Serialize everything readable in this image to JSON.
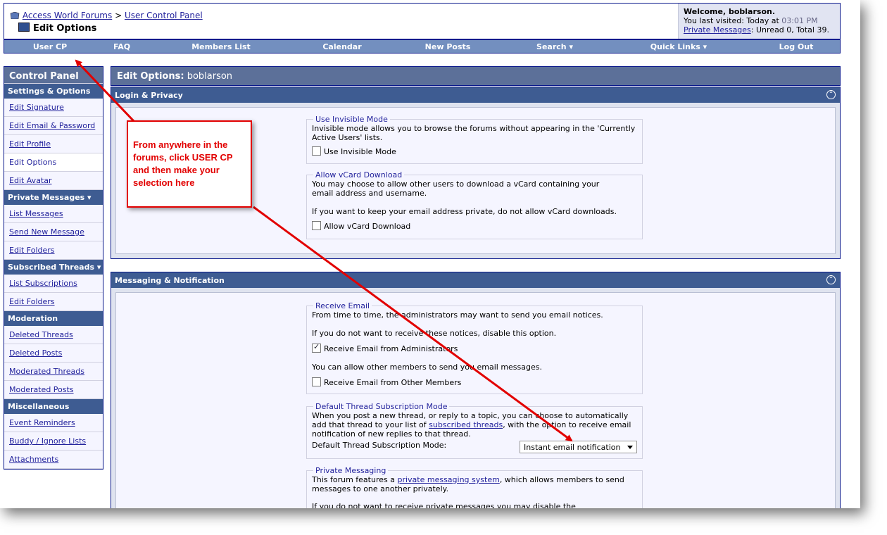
{
  "header": {
    "breadcrumb_home": "Access World Forums",
    "breadcrumb_sep": ">",
    "breadcrumb_cp": "User Control Panel",
    "page_title": "Edit Options",
    "welcome": "Welcome, boblarson.",
    "last_visited_prefix": "You last visited: Today at ",
    "last_visited_time": "03:01 PM",
    "private_messages_link": "Private Messages",
    "pm_status": ": Unread 0, Total 39."
  },
  "nav": {
    "items": [
      "User CP",
      "FAQ",
      "Members List",
      "Calendar",
      "New Posts",
      "Search ▾",
      "Quick Links ▾",
      "Log Out"
    ]
  },
  "sidebar": {
    "title": "Control Panel",
    "sections": [
      {
        "label": "Settings & Options",
        "items": [
          "Edit Signature",
          "Edit Email & Password",
          "Edit Profile",
          "Edit Options",
          "Edit Avatar"
        ]
      },
      {
        "label": "Private Messages ▾",
        "items": [
          "List Messages",
          "Send New Message",
          "Edit Folders"
        ]
      },
      {
        "label": "Subscribed Threads ▾",
        "items": [
          "List Subscriptions",
          "Edit Folders"
        ]
      },
      {
        "label": "Moderation",
        "items": [
          "Deleted Threads",
          "Deleted Posts",
          "Moderated Threads",
          "Moderated Posts"
        ]
      },
      {
        "label": "Miscellaneous",
        "items": [
          "Event Reminders",
          "Buddy / Ignore Lists",
          "Attachments"
        ]
      }
    ]
  },
  "main": {
    "title_prefix": "Edit Options:",
    "title_user": "boblarson",
    "login_privacy": {
      "heading": "Login & Privacy",
      "invisible_legend": "Use Invisible Mode",
      "invisible_desc": "Invisible mode allows you to browse the forums without appearing in the 'Currently Active Users' lists.",
      "invisible_label": "Use Invisible Mode",
      "vcard_legend": "Allow vCard Download",
      "vcard_desc1": "You may choose to allow other users to download a vCard containing your email address and username.",
      "vcard_desc2": "If you want to keep your email address private, do not allow vCard downloads.",
      "vcard_label": "Allow vCard Download"
    },
    "messaging": {
      "heading": "Messaging & Notification",
      "email_legend": "Receive Email",
      "email_desc1": "From time to time, the administrators may want to send you email notices.",
      "email_desc2": "If you do not want to receive these notices, disable this option.",
      "email_admin_label": "Receive Email from Administrators",
      "email_members_desc": "You can allow other members to send you email messages.",
      "email_members_label": "Receive Email from Other Members",
      "sub_legend": "Default Thread Subscription Mode",
      "sub_desc_a": "When you post a new thread, or reply to a topic, you can choose to automatically add that thread to your list of ",
      "sub_desc_link": "subscribed threads",
      "sub_desc_b": ", with the option to receive email notification of new replies to that thread.",
      "sub_mode_label": "Default Thread Subscription Mode:",
      "sub_mode_value": "Instant email notification",
      "pm_legend": "Private Messaging",
      "pm_desc_a": "This forum features a ",
      "pm_desc_link": "private messaging system",
      "pm_desc_b": ", which allows members to send messages to one another privately.",
      "pm_desc2": "If you do not want to receive private messages you may disable the"
    }
  },
  "callout": {
    "text": "From anywhere in the forums, click USER CP and then make your selection here"
  },
  "colors": {
    "navbar": "#738fbf",
    "section_header": "#3e5c92",
    "panel_title": "#5c7099",
    "annotation_red": "#e20000"
  }
}
